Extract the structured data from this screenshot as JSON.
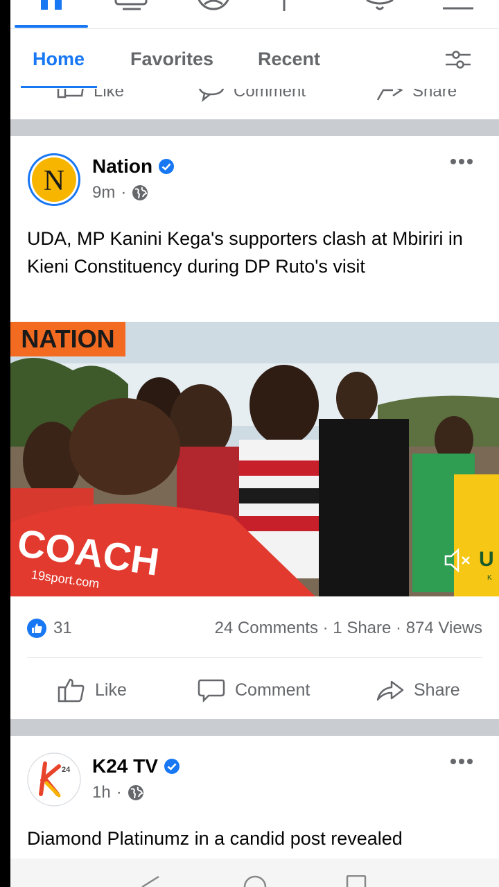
{
  "top_icons": [
    "home-icon",
    "watch-icon",
    "profile-icon",
    "marketplace-icon",
    "notifications-icon",
    "menu-icon"
  ],
  "tabs": [
    {
      "label": "Home",
      "active": true
    },
    {
      "label": "Favorites",
      "active": false
    },
    {
      "label": "Recent",
      "active": false
    }
  ],
  "prev_post_actions": {
    "like": "Like",
    "comment": "Comment",
    "share": "Share"
  },
  "posts": [
    {
      "author": "Nation",
      "avatar_letter": "N",
      "verified": true,
      "time": "9m",
      "text": "UDA, MP Kanini Kega's supporters clash at Mbiriri in Kieni Constituency during DP Ruto's visit",
      "media": {
        "badge": "NATION",
        "shirt_text": "COACH",
        "shirt_subtext": "19sport.com",
        "sign_letter": "U",
        "sign_small": "K"
      },
      "likes": "31",
      "comments": "24 Comments",
      "shares": "1 Share",
      "views": "874 Views",
      "actions": {
        "like": "Like",
        "comment": "Comment",
        "share": "Share"
      }
    },
    {
      "author": "K24 TV",
      "verified": true,
      "time": "1h",
      "logo_small": "24",
      "text": "Diamond Platinumz in a candid post revealed"
    }
  ],
  "colors": {
    "accent": "#1877f2",
    "nation_orange": "#f36b21",
    "nation_yellow": "#f7b500"
  }
}
